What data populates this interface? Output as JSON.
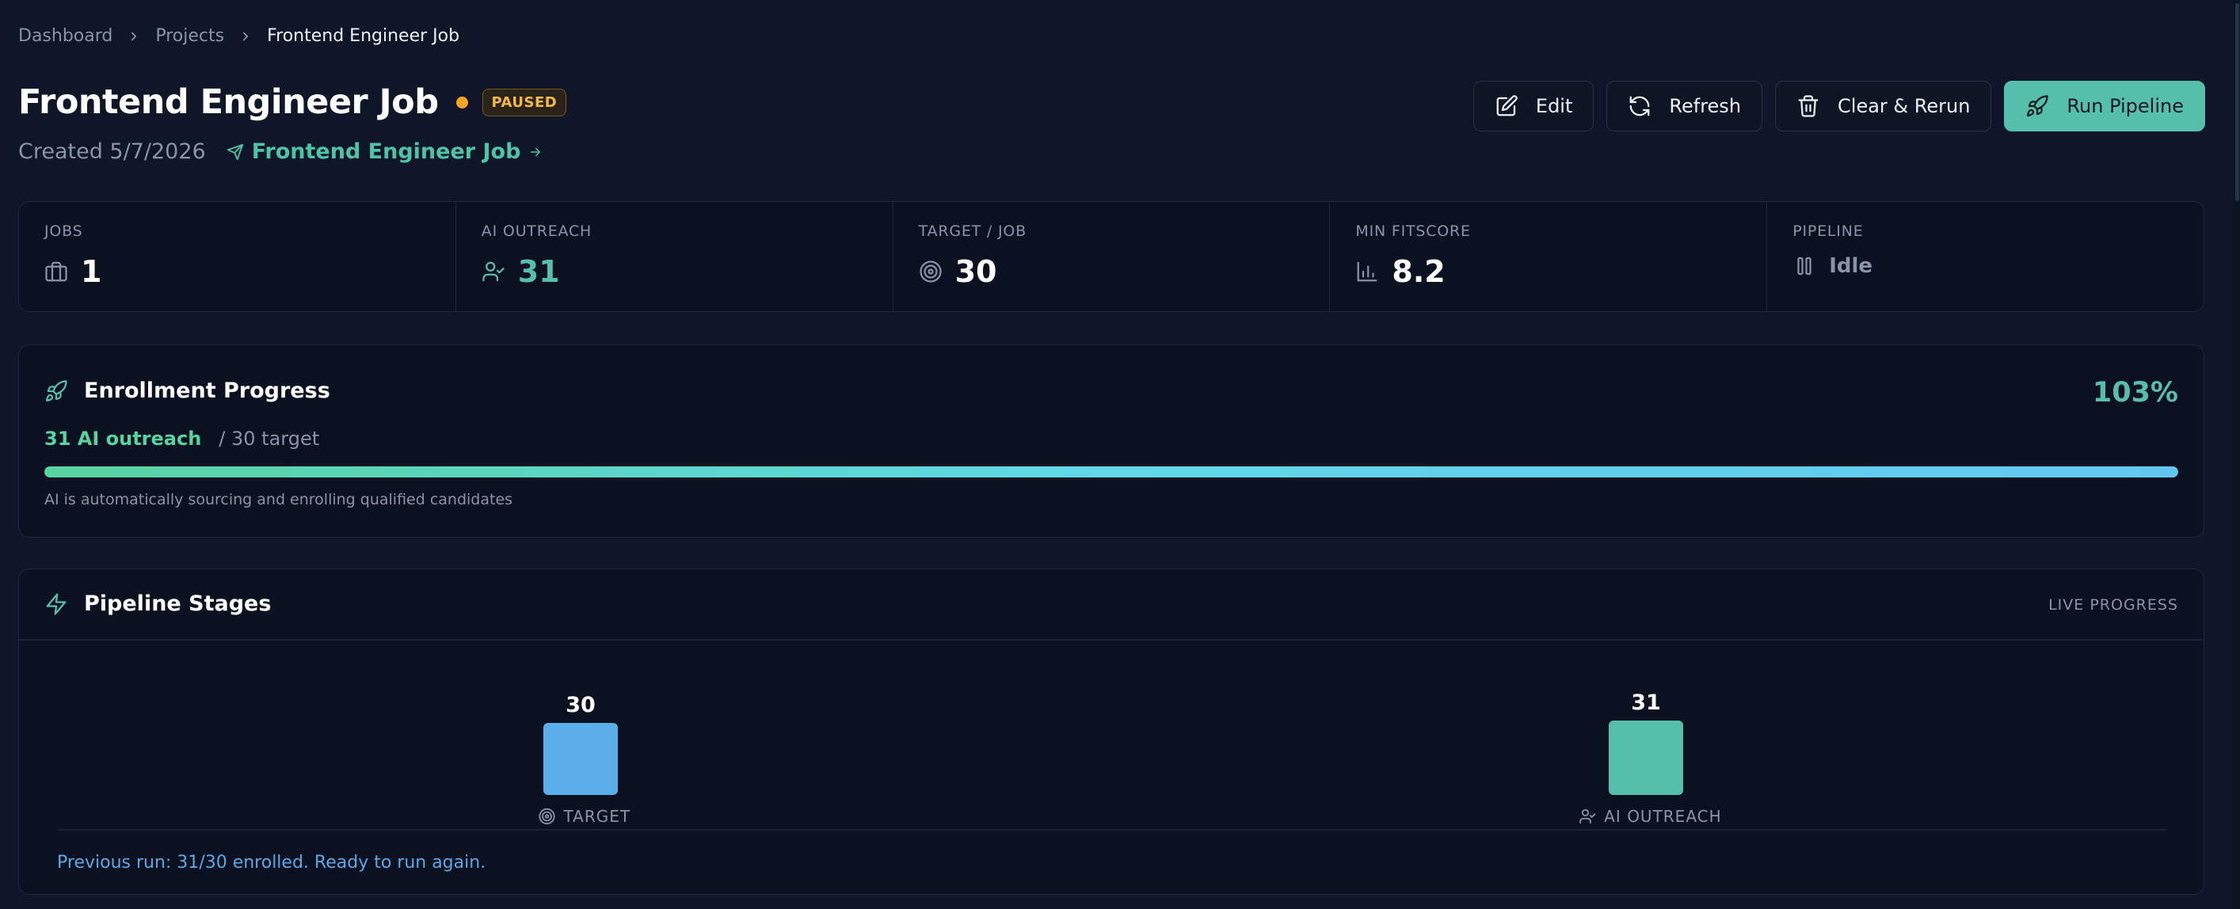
{
  "breadcrumb": {
    "items": [
      "Dashboard",
      "Projects"
    ],
    "current": "Frontend Engineer Job"
  },
  "header": {
    "title": "Frontend Engineer Job",
    "status": "PAUSED",
    "status_color": "#f5a524",
    "created": "Created 5/7/2026",
    "job_link_label": "Frontend Engineer Job"
  },
  "toolbar": {
    "edit_label": "Edit",
    "refresh_label": "Refresh",
    "clear_rerun_label": "Clear & Rerun",
    "run_pipeline_label": "Run Pipeline"
  },
  "stats": [
    {
      "label": "JOBS",
      "value": "1",
      "icon": "briefcase-icon"
    },
    {
      "label": "AI OUTREACH",
      "value": "31",
      "icon": "user-check-icon"
    },
    {
      "label": "TARGET / JOB",
      "value": "30",
      "icon": "target-icon"
    },
    {
      "label": "MIN FITSCORE",
      "value": "8.2",
      "icon": "bar-chart-icon"
    },
    {
      "label": "PIPELINE",
      "value": "Idle",
      "icon": "pause-icon"
    }
  ],
  "enrollment": {
    "title": "Enrollment Progress",
    "percent": "103%",
    "outreach": "31 AI outreach",
    "target": "/ 30 target",
    "progress_fraction": 1.0,
    "caption": "AI is automatically sourcing and enrolling qualified candidates"
  },
  "pipeline": {
    "title": "Pipeline Stages",
    "live_label": "LIVE PROGRESS",
    "previous_run": "Previous run: 31/30 enrolled. Ready to run again."
  },
  "chart_data": {
    "type": "bar",
    "categories": [
      "TARGET",
      "AI OUTREACH"
    ],
    "values": [
      30,
      31
    ],
    "colors": [
      "#5aaee9",
      "#56bfac"
    ],
    "icons": [
      "target-icon",
      "user-check-icon"
    ]
  },
  "colors": {
    "accent": "#56bfac",
    "background": "#0f1628",
    "card": "#0b1120"
  }
}
